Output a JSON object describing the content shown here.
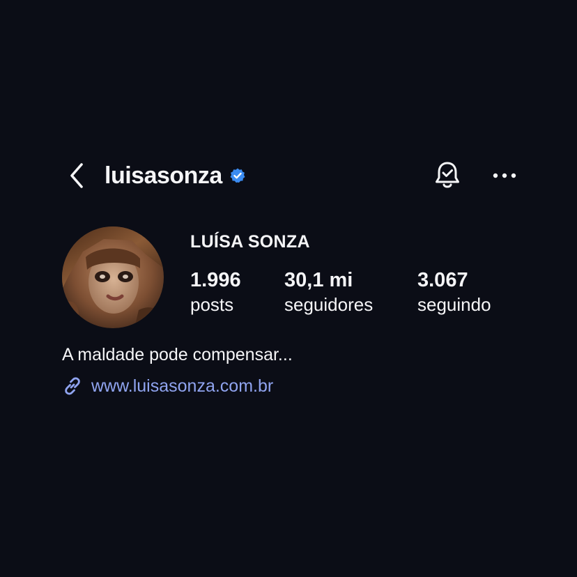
{
  "header": {
    "username": "luisasonza",
    "verified": true,
    "back_icon": "chevron-left-icon",
    "notification_icon": "bell-check-icon",
    "more_icon": "ellipsis-icon"
  },
  "profile": {
    "display_name": "LUÍSA SONZA",
    "avatar_icon": "profile-photo",
    "stats": [
      {
        "value": "1.996",
        "label": "posts"
      },
      {
        "value": "30,1 mi",
        "label": "seguidores"
      },
      {
        "value": "3.067",
        "label": "seguindo"
      }
    ],
    "bio": "A maldade pode compensar...",
    "link": "www.luisasonza.com.br",
    "link_icon": "link-icon"
  },
  "colors": {
    "background": "#0b0d16",
    "text": "#f5f5f7",
    "link": "#90a4f0",
    "verified_badge": "#3b8cf2"
  }
}
